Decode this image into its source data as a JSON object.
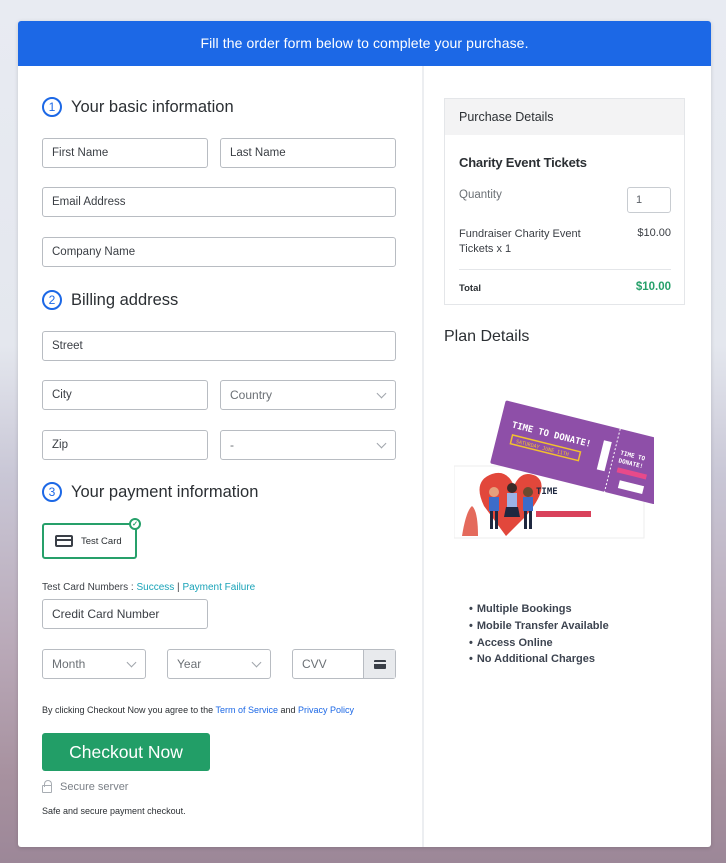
{
  "banner": {
    "text": "Fill the order form below to complete your purchase."
  },
  "sections": {
    "basic": {
      "number": "1",
      "title": "Your basic information"
    },
    "billing": {
      "number": "2",
      "title": "Billing address"
    },
    "payment": {
      "number": "3",
      "title": "Your payment information"
    }
  },
  "fields": {
    "first_name": {
      "placeholder": "First Name"
    },
    "last_name": {
      "placeholder": "Last Name"
    },
    "email": {
      "placeholder": "Email Address"
    },
    "company": {
      "placeholder": "Company Name"
    },
    "street": {
      "placeholder": "Street"
    },
    "city": {
      "placeholder": "City"
    },
    "country": {
      "value": "Country"
    },
    "zip": {
      "placeholder": "Zip"
    },
    "state": {
      "value": "-"
    },
    "card_number": {
      "placeholder": "Credit Card Number"
    },
    "month": {
      "value": "Month"
    },
    "year": {
      "value": "Year"
    },
    "cvv": {
      "placeholder": "CVV"
    }
  },
  "payment": {
    "method_label": "Test Card",
    "test_numbers_label": "Test Card Numbers : ",
    "success_link": "Success",
    "separator": " | ",
    "failure_link": "Payment Failure"
  },
  "terms": {
    "prefix": "By clicking Checkout Now you agree to the ",
    "tos_link": "Term of Service",
    "and": " and ",
    "privacy_link": "Privacy Policy"
  },
  "checkout": {
    "button_label": "Checkout Now",
    "secure_label": "Secure server",
    "safe_text": "Safe and secure payment checkout."
  },
  "purchase": {
    "header": "Purchase Details",
    "product_title": "Charity Event Tickets",
    "quantity_label": "Quantity",
    "quantity_value": "1",
    "line_item": "Fundraiser Charity Event Tickets x 1",
    "line_price": "$10.00",
    "total_label": "Total",
    "total_value": "$10.00"
  },
  "plan": {
    "title": "Plan Details",
    "image_alt": "Charity event tickets - Time to Donate",
    "ticket_text": "TIME TO DONATE!",
    "ticket_date": "SATURDAY JUNE 11TH",
    "features": [
      "Multiple Bookings",
      "Mobile Transfer Available",
      "Access Online",
      "No Additional Charges"
    ]
  },
  "colors": {
    "brand_blue": "#1c68e6",
    "success_green": "#229e67",
    "link_teal": "#1aa3b8"
  }
}
